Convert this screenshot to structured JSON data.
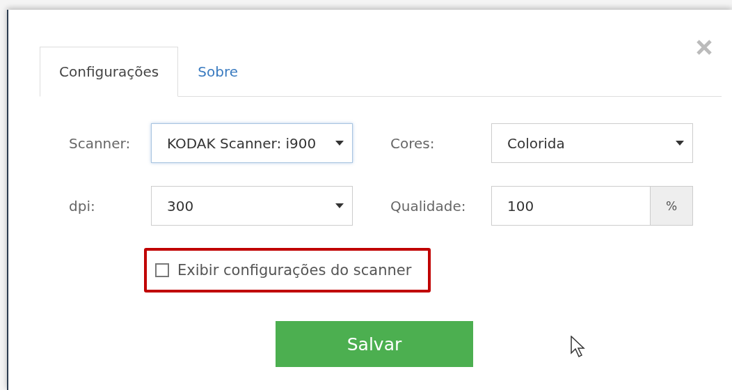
{
  "tabs": [
    {
      "label": "Configurações",
      "selected": true
    },
    {
      "label": "Sobre",
      "selected": false
    }
  ],
  "fields": [
    {
      "label": "Scanner:",
      "kind": "select",
      "value": "KODAK Scanner: i900",
      "focused": true
    },
    {
      "label": "Cores:",
      "kind": "select",
      "value": "Colorida",
      "focused": false
    },
    {
      "label": "dpi:",
      "kind": "select",
      "value": "300",
      "focused": false
    },
    {
      "label": "Qualidade:",
      "kind": "addon",
      "value": "100",
      "addon": "%",
      "focused": false
    }
  ],
  "option": {
    "label": "Exibir configurações do scanner",
    "checked": false,
    "highlighted": true
  },
  "save_button": "Salvar"
}
